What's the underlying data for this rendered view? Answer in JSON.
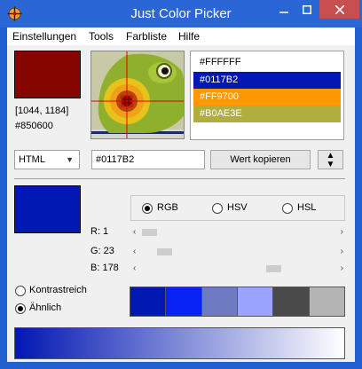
{
  "window": {
    "title": "Just Color Picker",
    "minimize_icon": "minimize-icon",
    "maximize_icon": "maximize-icon",
    "close_icon": "close-icon"
  },
  "menu": {
    "items": [
      "Einstellungen",
      "Tools",
      "Farbliste",
      "Hilfe"
    ]
  },
  "picked": {
    "color": "#850600",
    "coords": "[1044, 1184]",
    "hex": "#850600"
  },
  "color_list": [
    {
      "label": "#FFFFFF",
      "bg": "#ffffff",
      "fg": "#000000"
    },
    {
      "label": "#0117B2",
      "bg": "#0117b2",
      "fg": "#ffffff"
    },
    {
      "label": "#FF9700",
      "bg": "#ff9700",
      "fg": "#ffffff"
    },
    {
      "label": "#B0AE3E",
      "bg": "#b0ae3e",
      "fg": "#ffffff"
    }
  ],
  "format": {
    "selected": "HTML"
  },
  "hex_input": {
    "value": "#0117B2"
  },
  "copy_button": "Wert kopieren",
  "current": {
    "color": "#0117b2"
  },
  "modes": [
    {
      "label": "RGB",
      "selected": true
    },
    {
      "label": "HSV",
      "selected": false
    },
    {
      "label": "HSL",
      "selected": false
    }
  ],
  "sliders": [
    {
      "label": "R: 1",
      "value": 1,
      "max": 255
    },
    {
      "label": "G: 23",
      "value": 23,
      "max": 255
    },
    {
      "label": "B: 178",
      "value": 178,
      "max": 255
    }
  ],
  "harmony": [
    {
      "label": "Kontrastreich",
      "selected": false
    },
    {
      "label": "Ähnlich",
      "selected": true
    }
  ],
  "palette": [
    "#0117b2",
    "#0a23f5",
    "#6e7bc2",
    "#9aa4ff",
    "#4a4a4a",
    "#b4b4b4"
  ],
  "gradient": {
    "from": "#0117b2",
    "to": "#ffffff"
  }
}
